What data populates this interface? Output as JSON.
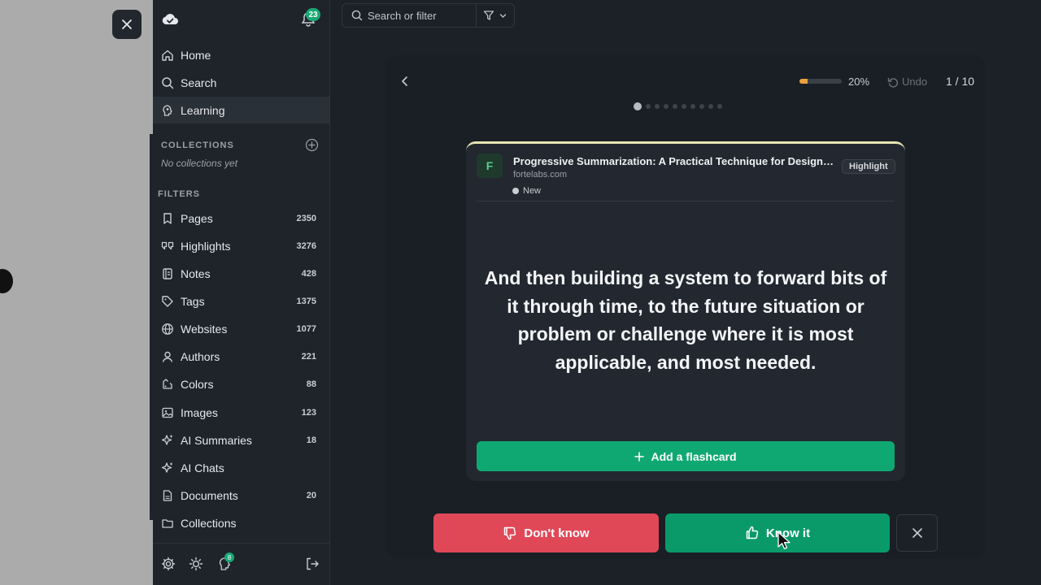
{
  "sidebar": {
    "notifications_count": "23",
    "nav": [
      {
        "label": "Home",
        "icon": "home-icon"
      },
      {
        "label": "Search",
        "icon": "search-icon"
      },
      {
        "label": "Learning",
        "icon": "brain-icon",
        "active": true
      }
    ],
    "collections": {
      "heading": "COLLECTIONS",
      "empty_text": "No collections yet"
    },
    "filters": {
      "heading": "FILTERS",
      "items": [
        {
          "label": "Pages",
          "count": "2350",
          "icon": "bookmark-icon"
        },
        {
          "label": "Highlights",
          "count": "3276",
          "icon": "quote-icon"
        },
        {
          "label": "Notes",
          "count": "428",
          "icon": "notebook-icon"
        },
        {
          "label": "Tags",
          "count": "1375",
          "icon": "tag-icon"
        },
        {
          "label": "Websites",
          "count": "1077",
          "icon": "globe-icon"
        },
        {
          "label": "Authors",
          "count": "221",
          "icon": "person-icon"
        },
        {
          "label": "Colors",
          "count": "88",
          "icon": "palette-icon"
        },
        {
          "label": "Images",
          "count": "123",
          "icon": "image-icon"
        },
        {
          "label": "AI Summaries",
          "count": "18",
          "icon": "sparkle-icon"
        },
        {
          "label": "AI Chats",
          "count": "",
          "icon": "sparkle-icon"
        },
        {
          "label": "Documents",
          "count": "20",
          "icon": "document-icon"
        },
        {
          "label": "Collections",
          "count": "",
          "icon": "folder-icon"
        }
      ]
    },
    "bottom": {
      "learning_badge": "8"
    }
  },
  "search": {
    "placeholder": "Search or filter"
  },
  "session": {
    "progress_percent": 20,
    "progress_label": "20%",
    "undo_label": "Undo",
    "counter": "1 / 10",
    "total_cards": 10,
    "current_index": 1
  },
  "card": {
    "source_letter": "F",
    "source_title": "Progressive Summarization: A Practical Technique for Designing Discoverable Notes",
    "source_site": "fortelabs.com",
    "status": "New",
    "type_chip": "Highlight",
    "quote": "And then building a system to forward bits of it through time, to the future situation or problem or challenge where it is most applicable, and most needed.",
    "add_flashcard_label": "Add a flashcard"
  },
  "actions": {
    "dont_know_label": "Don't know",
    "know_it_label": "Know it"
  },
  "colors": {
    "accent_green": "#0fa872",
    "danger_red": "#e04858",
    "progress_orange": "#f0a03c",
    "card_top_border": "#e9e4b3"
  }
}
